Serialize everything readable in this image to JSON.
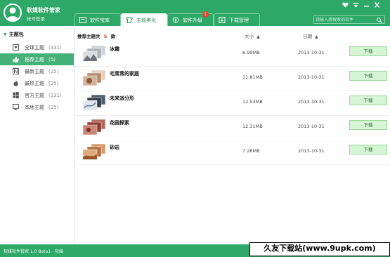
{
  "app": {
    "name": "软媒软件管家",
    "login_text": "帐号登录"
  },
  "tabs": [
    {
      "label": "软件宝库",
      "icon": "software-library-icon",
      "active": false
    },
    {
      "label": "主题美化",
      "icon": "theme-shirt-icon",
      "active": true
    },
    {
      "label": "软件升级",
      "icon": "upgrade-icon",
      "active": false,
      "badge": "1"
    },
    {
      "label": "下载管理",
      "icon": "download-manage-icon",
      "active": false
    }
  ],
  "search": {
    "placeholder": "请输入想搜索的软件"
  },
  "window_controls": [
    "heart-icon",
    "menu-icon",
    "minimize-icon",
    "close-icon"
  ],
  "sidebar": {
    "header": "主题包",
    "items": [
      {
        "label": "全球主题",
        "count": "(331)",
        "icon": "globe-theme-icon",
        "active": false
      },
      {
        "label": "推荐主题",
        "count": "(5)",
        "icon": "thumbs-up-icon",
        "active": true
      },
      {
        "label": "最新主题",
        "count": "(25)",
        "icon": "new-icon",
        "active": false
      },
      {
        "label": "最热主题",
        "count": "(25)",
        "icon": "fire-icon",
        "active": false
      },
      {
        "label": "官方主题",
        "count": "(331)",
        "icon": "windows-logo-icon",
        "active": false
      },
      {
        "label": "本地主题",
        "count": "(25)",
        "icon": "monitor-icon",
        "active": false
      }
    ]
  },
  "list": {
    "title_prefix": "推荐主题共",
    "count": "5",
    "title_suffix": "款",
    "col_size": "大小",
    "col_date": "日期",
    "download_label": "下载",
    "rows": [
      {
        "name": "冰霜",
        "size": "6.99MB",
        "date": "2013-10-31"
      },
      {
        "name": "毛茸茸的家庭",
        "size": "11.81MB",
        "date": "2013-10-31"
      },
      {
        "name": "未来派分形",
        "size": "12.53MB",
        "date": "2013-10-31"
      },
      {
        "name": "花园探索",
        "size": "12.31MB",
        "date": "2013-10-31"
      },
      {
        "name": "砂岩",
        "size": "7.26MB",
        "date": "2013-10-31"
      }
    ]
  },
  "statusbar": {
    "text": "软媒软件管家 1.0 Beta1 - 软媒"
  },
  "watermark": {
    "text": "久友下载站(www.9upk.com)"
  },
  "colors": {
    "brand_green": "#2da866",
    "sidebar_active": "#44b178",
    "download_button": "#d5f5d5",
    "badge_red": "#e8422f"
  }
}
